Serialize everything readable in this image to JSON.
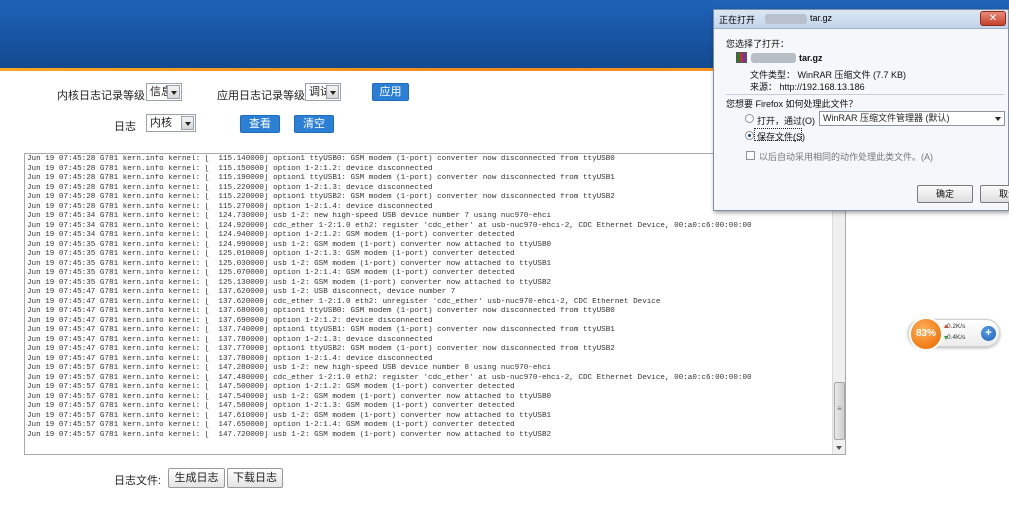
{
  "form": {
    "kernel_level_label": "内核日志记录等级",
    "kernel_level_value": "信息",
    "app_level_label": "应用日志记录等级",
    "app_level_value": "调试",
    "apply_label": "应用",
    "log_label": "日志",
    "log_value": "内核",
    "view_label": "查看",
    "clear_label": "清空"
  },
  "log_lines": [
    "Jun 19 07:45:28 G781 kern.info kernel: [  115.140000] option1 ttyUSB0: GSM modem (1-port) converter now disconnected from ttyUSB0",
    "Jun 19 07:45:28 G781 kern.info kernel: [  115.150000] option 1-2:1.2: device disconnected",
    "Jun 19 07:45:28 G781 kern.info kernel: [  115.190000] option1 ttyUSB1: GSM modem (1-port) converter now disconnected from ttyUSB1",
    "Jun 19 07:45:28 G781 kern.info kernel: [  115.220000] option 1-2:1.3: device disconnected",
    "Jun 19 07:45:28 G781 kern.info kernel: [  115.220000] option1 ttyUSB2: GSM modem (1-port) converter now disconnected from ttyUSB2",
    "Jun 19 07:45:28 G781 kern.info kernel: [  115.270000] option 1-2:1.4: device disconnected",
    "Jun 19 07:45:34 G781 kern.info kernel: [  124.730000] usb 1-2: new high-speed USB device number 7 using nuc970-ehci",
    "Jun 19 07:45:34 G781 kern.info kernel: [  124.920000] cdc_ether 1-2:1.0 eth2: register 'cdc_ether' at usb-nuc970-ehci-2, CDC Ethernet Device, 00:a0:c6:00:00:00",
    "Jun 19 07:45:34 G781 kern.info kernel: [  124.940000] option 1-2:1.2: GSM modem (1-port) converter detected",
    "Jun 19 07:45:35 G781 kern.info kernel: [  124.990000] usb 1-2: GSM modem (1-port) converter now attached to ttyUSB0",
    "Jun 19 07:45:35 G781 kern.info kernel: [  125.010000] option 1-2:1.3: GSM modem (1-port) converter detected",
    "Jun 19 07:45:35 G781 kern.info kernel: [  125.030000] usb 1-2: GSM modem (1-port) converter now attached to ttyUSB1",
    "Jun 19 07:45:35 G781 kern.info kernel: [  125.070000] option 1-2:1.4: GSM modem (1-port) converter detected",
    "Jun 19 07:45:35 G781 kern.info kernel: [  125.130000] usb 1-2: GSM modem (1-port) converter now attached to ttyUSB2",
    "Jun 19 07:45:47 G781 kern.info kernel: [  137.620000] usb 1-2: USB disconnect, device number 7",
    "Jun 19 07:45:47 G781 kern.info kernel: [  137.620000] cdc_ether 1-2:1.0 eth2: unregister 'cdc_ether' usb-nuc970-ehci-2, CDC Ethernet Device",
    "Jun 19 07:45:47 G781 kern.info kernel: [  137.680000] option1 ttyUSB0: GSM modem (1-port) converter now disconnected from ttyUSB0",
    "Jun 19 07:45:47 G781 kern.info kernel: [  137.690000] option 1-2:1.2: device disconnected",
    "Jun 19 07:45:47 G781 kern.info kernel: [  137.740000] option1 ttyUSB1: GSM modem (1-port) converter now disconnected from ttyUSB1",
    "Jun 19 07:45:47 G781 kern.info kernel: [  137.780000] option 1-2:1.3: device disconnected",
    "Jun 19 07:45:47 G781 kern.info kernel: [  137.770000] option1 ttyUSB2: GSM modem (1-port) converter now disconnected from ttyUSB2",
    "Jun 19 07:45:47 G781 kern.info kernel: [  137.780000] option 1-2:1.4: device disconnected",
    "Jun 19 07:45:57 G781 kern.info kernel: [  147.280000] usb 1-2: new high-speed USB device number 8 using nuc970-ehci",
    "Jun 19 07:45:57 G781 kern.info kernel: [  147.480000] cdc_ether 1-2:1.0 eth2: register 'cdc_ether' at usb-nuc970-ehci-2, CDC Ethernet Device, 00:a0:c6:00:00:00",
    "Jun 19 07:45:57 G781 kern.info kernel: [  147.500000] option 1-2:1.2: GSM modem (1-port) converter detected",
    "Jun 19 07:45:57 G781 kern.info kernel: [  147.540000] usb 1-2: GSM modem (1-port) converter now attached to ttyUSB0",
    "Jun 19 07:45:57 G781 kern.info kernel: [  147.580000] option 1-2:1.3: GSM modem (1-port) converter detected",
    "Jun 19 07:45:57 G781 kern.info kernel: [  147.610000] usb 1-2: GSM modem (1-port) converter now attached to ttyUSB1",
    "Jun 19 07:45:57 G781 kern.info kernel: [  147.650000] option 1-2:1.4: GSM modem (1-port) converter detected",
    "Jun 19 07:45:57 G781 kern.info kernel: [  147.720000] usb 1-2: GSM modem (1-port) converter now attached to ttyUSB2"
  ],
  "footer": {
    "file_label": "日志文件:",
    "generate_label": "生成日志",
    "download_label": "下载日志"
  },
  "dialog": {
    "title_prefix": "正在打开",
    "title_suffix": "tar.gz",
    "close_glyph": "✕",
    "you_chose": "您选择了打开：",
    "file_suffix": "tar.gz",
    "file_type": "文件类型： WinRAR 压缩文件 (7.7 KB)",
    "source": "来源： http://192.168.13.186",
    "question": "您想要 Firefox 如何处理此文件？",
    "open_with": "打开，通过(O)",
    "open_with_app": "WinRAR 压缩文件管理器 (默认)",
    "save_file": "保存文件(S)",
    "remember": "以后自动采用相同的动作处理此类文件。(A)",
    "ok_label": "确定",
    "cancel_label": "取消"
  },
  "widget": {
    "percent": "83%",
    "up_rate": "0.2K/s",
    "down_rate": "0.4K/s",
    "plus_glyph": "+"
  },
  "colors": {
    "header_blue": "#1753a0",
    "accent_orange": "#f08a1c",
    "button_blue": "#2b80d6"
  }
}
